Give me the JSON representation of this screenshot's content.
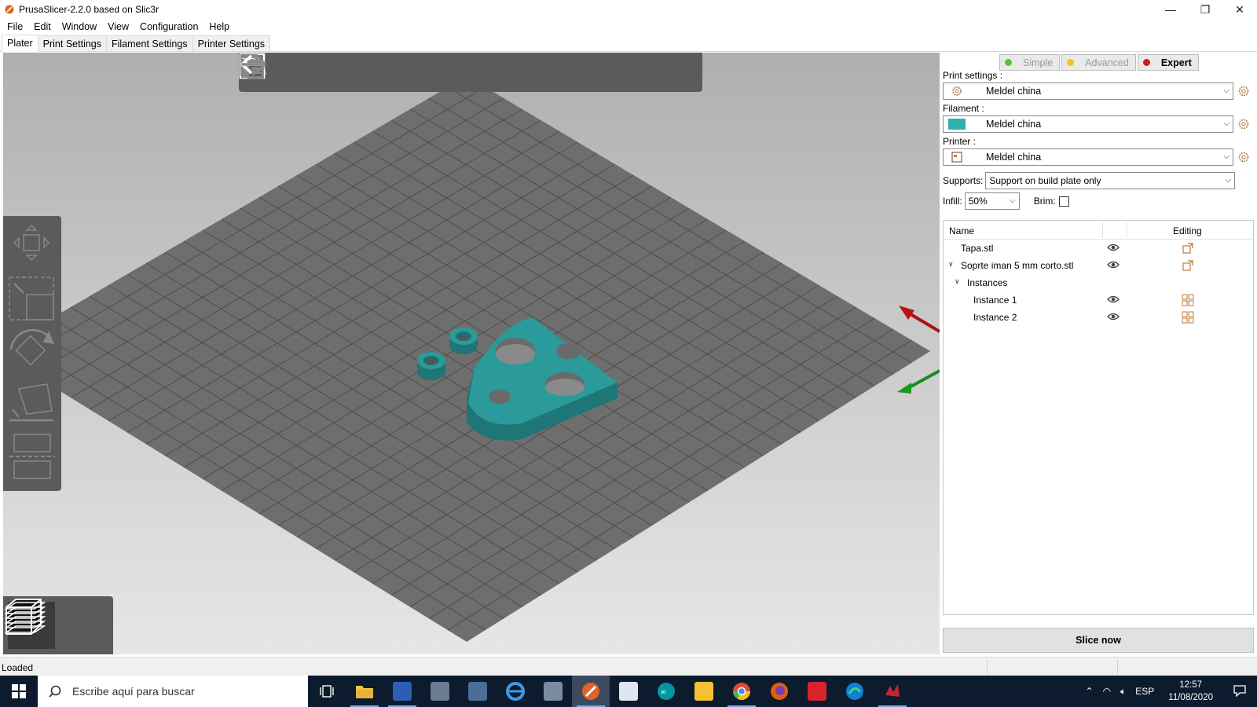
{
  "window": {
    "title": "PrusaSlicer-2.2.0 based on Slic3r",
    "min_glyph": "—",
    "max_glyph": "❐",
    "close_glyph": "✕"
  },
  "menu": [
    "File",
    "Edit",
    "Window",
    "View",
    "Configuration",
    "Help"
  ],
  "tabs": [
    "Plater",
    "Print Settings",
    "Filament Settings",
    "Printer Settings"
  ],
  "mode": {
    "simple": "Simple",
    "advanced": "Advanced",
    "expert": "Expert",
    "colors": {
      "simple": "#5bc236",
      "advanced": "#f2c41d",
      "expert": "#d41b1b"
    }
  },
  "print_settings": {
    "label": "Print settings :",
    "value": "Meldel china"
  },
  "filament": {
    "label": "Filament :",
    "value": "Meldel china",
    "color": "#2eb0b0"
  },
  "printer": {
    "label": "Printer :",
    "value": "Meldel china"
  },
  "supports": {
    "label": "Supports:",
    "value": "Support on build plate only"
  },
  "infill": {
    "label": "Infill:",
    "value": "50%"
  },
  "brim": {
    "label": "Brim:",
    "checked": false
  },
  "object_list": {
    "col_name": "Name",
    "col_editing": "Editing",
    "rows": [
      {
        "name": "Tapa.stl",
        "toggle": ""
      },
      {
        "name": "Soprte iman 5  mm corto.stl",
        "toggle": "∨"
      },
      {
        "name": "Instances",
        "toggle": "∨"
      },
      {
        "name": "Instance 1",
        "toggle": ""
      },
      {
        "name": "Instance 2",
        "toggle": ""
      }
    ]
  },
  "slice_button": "Slice now",
  "status": "Loaded",
  "taskbar": {
    "search_placeholder": "Escribe aquí para buscar",
    "lang": "ESP",
    "time": "12:57",
    "date": "11/08/2020"
  },
  "colors": {
    "model": "#2b9a9a",
    "model_dark": "#1f7878",
    "bed": "#666666"
  }
}
